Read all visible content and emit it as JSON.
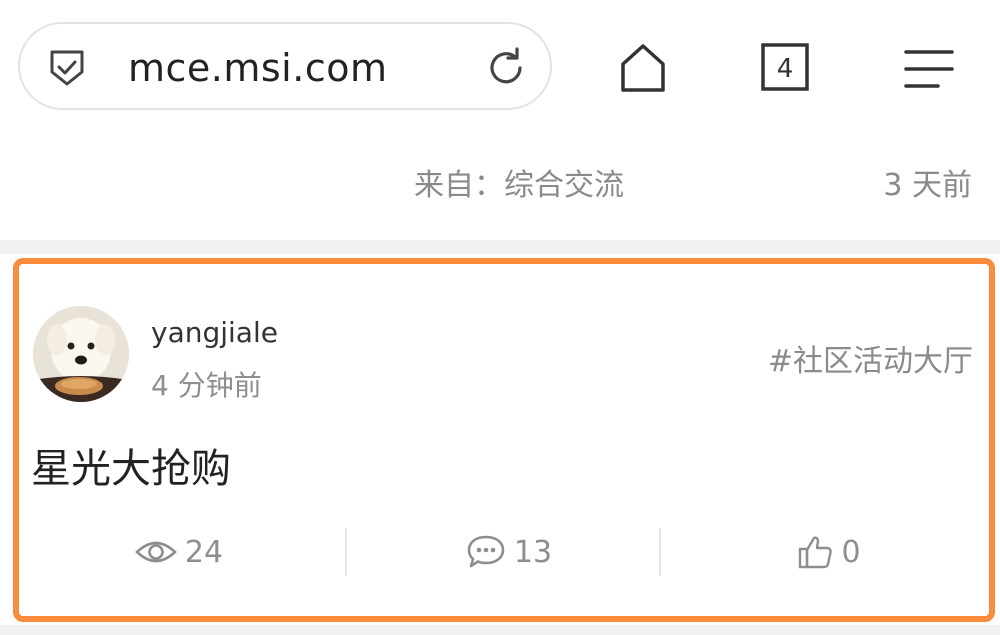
{
  "browser": {
    "url": "mce.msi.com",
    "tab_count": "4"
  },
  "prev_item": {
    "source": "来自：综合交流",
    "time": "3 天前"
  },
  "post": {
    "author": "yangjiale",
    "time": "4 分钟前",
    "tag": "#社区活动大厅",
    "title": "星光大抢购",
    "stats": {
      "views": "24",
      "comments": "13",
      "likes": "0"
    }
  },
  "icons": {
    "security": "shield-check-icon",
    "reload": "reload-icon",
    "home": "home-icon",
    "tabs": "tabs-icon",
    "menu": "menu-icon",
    "views": "eye-icon",
    "comments": "comment-bubble-icon",
    "likes": "thumbs-up-icon"
  },
  "colors": {
    "highlight": "#fb8c3c",
    "muted_text": "#8a8a8a"
  }
}
